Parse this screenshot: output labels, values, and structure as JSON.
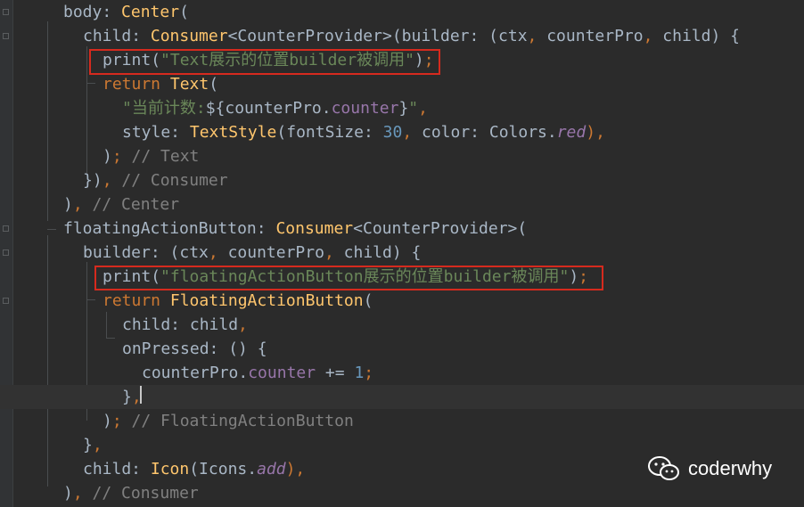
{
  "editor": {
    "lines": [
      {
        "tokens": [
          {
            "t": "body",
            "c": "plain"
          },
          {
            "t": ": ",
            "c": "plain"
          },
          {
            "t": "Center",
            "c": "cls"
          },
          {
            "t": "(",
            "c": "plain"
          }
        ]
      },
      {
        "tokens": [
          {
            "t": "child",
            "c": "plain"
          },
          {
            "t": ": ",
            "c": "plain"
          },
          {
            "t": "Consumer",
            "c": "cls"
          },
          {
            "t": "<CounterProvider>",
            "c": "plain"
          },
          {
            "t": "(builder: (ctx",
            "c": "plain"
          },
          {
            "t": ", ",
            "c": "punc"
          },
          {
            "t": "counterPro",
            "c": "plain"
          },
          {
            "t": ", ",
            "c": "punc"
          },
          {
            "t": "child) {",
            "c": "plain"
          }
        ]
      },
      {
        "tokens": [
          {
            "t": "print",
            "c": "plain"
          },
          {
            "t": "(",
            "c": "plain"
          },
          {
            "t": "\"Text展示的位置builder被调用\"",
            "c": "str"
          },
          {
            "t": ")",
            "c": "plain"
          },
          {
            "t": ";",
            "c": "punc"
          }
        ]
      },
      {
        "tokens": [
          {
            "t": "return ",
            "c": "kw"
          },
          {
            "t": "Text",
            "c": "cls"
          },
          {
            "t": "(",
            "c": "plain"
          }
        ]
      },
      {
        "tokens": [
          {
            "t": "\"当前计数:",
            "c": "str"
          },
          {
            "t": "${",
            "c": "plain"
          },
          {
            "t": "counterPro",
            "c": "plain"
          },
          {
            "t": ".",
            "c": "plain"
          },
          {
            "t": "counter",
            "c": "prop"
          },
          {
            "t": "}",
            "c": "plain"
          },
          {
            "t": "\"",
            "c": "str"
          },
          {
            "t": ",",
            "c": "punc"
          }
        ]
      },
      {
        "tokens": [
          {
            "t": "style: ",
            "c": "plain"
          },
          {
            "t": "TextStyle",
            "c": "cls"
          },
          {
            "t": "(fontSize: ",
            "c": "plain"
          },
          {
            "t": "30",
            "c": "num"
          },
          {
            "t": ", ",
            "c": "punc"
          },
          {
            "t": "color: Colors.",
            "c": "plain"
          },
          {
            "t": "red",
            "c": "ital"
          },
          {
            "t": "),",
            "c": "punc"
          }
        ]
      },
      {
        "tokens": [
          {
            "t": ")",
            "c": "plain"
          },
          {
            "t": "; ",
            "c": "punc"
          },
          {
            "t": "// Text",
            "c": "com"
          }
        ]
      },
      {
        "tokens": [
          {
            "t": "})",
            "c": "plain"
          },
          {
            "t": ", ",
            "c": "punc"
          },
          {
            "t": "// Consumer",
            "c": "com"
          }
        ]
      },
      {
        "tokens": [
          {
            "t": ")",
            "c": "plain"
          },
          {
            "t": ", ",
            "c": "punc"
          },
          {
            "t": "// Center",
            "c": "com"
          }
        ]
      },
      {
        "tokens": [
          {
            "t": "floatingActionButton",
            "c": "plain"
          },
          {
            "t": ": ",
            "c": "plain"
          },
          {
            "t": "Consumer",
            "c": "cls"
          },
          {
            "t": "<CounterProvider>(",
            "c": "plain"
          }
        ]
      },
      {
        "tokens": [
          {
            "t": "builder: (ctx",
            "c": "plain"
          },
          {
            "t": ", ",
            "c": "punc"
          },
          {
            "t": "counterPro",
            "c": "plain"
          },
          {
            "t": ", ",
            "c": "punc"
          },
          {
            "t": "child) {",
            "c": "plain"
          }
        ]
      },
      {
        "tokens": [
          {
            "t": "print",
            "c": "plain"
          },
          {
            "t": "(",
            "c": "plain"
          },
          {
            "t": "\"floatingActionButton展示的位置builder被调用\"",
            "c": "str"
          },
          {
            "t": ")",
            "c": "plain"
          },
          {
            "t": ";",
            "c": "punc"
          }
        ]
      },
      {
        "tokens": [
          {
            "t": "return ",
            "c": "kw"
          },
          {
            "t": "FloatingActionButton",
            "c": "cls"
          },
          {
            "t": "(",
            "c": "plain"
          }
        ]
      },
      {
        "tokens": [
          {
            "t": "child: child",
            "c": "plain"
          },
          {
            "t": ",",
            "c": "punc"
          }
        ]
      },
      {
        "tokens": [
          {
            "t": "onPressed: () {",
            "c": "plain"
          }
        ]
      },
      {
        "tokens": [
          {
            "t": "counterPro",
            "c": "plain"
          },
          {
            "t": ".",
            "c": "plain"
          },
          {
            "t": "counter",
            "c": "prop"
          },
          {
            "t": " += ",
            "c": "plain"
          },
          {
            "t": "1",
            "c": "num"
          },
          {
            "t": ";",
            "c": "punc"
          }
        ]
      },
      {
        "tokens": [
          {
            "t": "}",
            "c": "plain"
          },
          {
            "t": ",",
            "c": "punc"
          }
        ]
      },
      {
        "tokens": [
          {
            "t": ")",
            "c": "plain"
          },
          {
            "t": "; ",
            "c": "punc"
          },
          {
            "t": "// FloatingActionButton",
            "c": "com"
          }
        ]
      },
      {
        "tokens": [
          {
            "t": "}",
            "c": "plain"
          },
          {
            "t": ",",
            "c": "punc"
          }
        ]
      },
      {
        "tokens": [
          {
            "t": "child: ",
            "c": "plain"
          },
          {
            "t": "Icon",
            "c": "cls"
          },
          {
            "t": "(Icons.",
            "c": "plain"
          },
          {
            "t": "add",
            "c": "ital"
          },
          {
            "t": "),",
            "c": "punc"
          }
        ]
      },
      {
        "tokens": [
          {
            "t": ")",
            "c": "plain"
          },
          {
            "t": ", ",
            "c": "punc"
          },
          {
            "t": "// Consumer",
            "c": "com"
          }
        ]
      }
    ]
  },
  "watermark": {
    "icon": "wechat-icon",
    "text": "coderwhy"
  },
  "colors": {
    "background": "#2b2b2b",
    "keyword": "#cc7832",
    "class": "#ffc66d",
    "string": "#6a8759",
    "number": "#6897bb",
    "property": "#9876aa",
    "comment": "#808080",
    "highlight_box": "#d62a1e"
  }
}
